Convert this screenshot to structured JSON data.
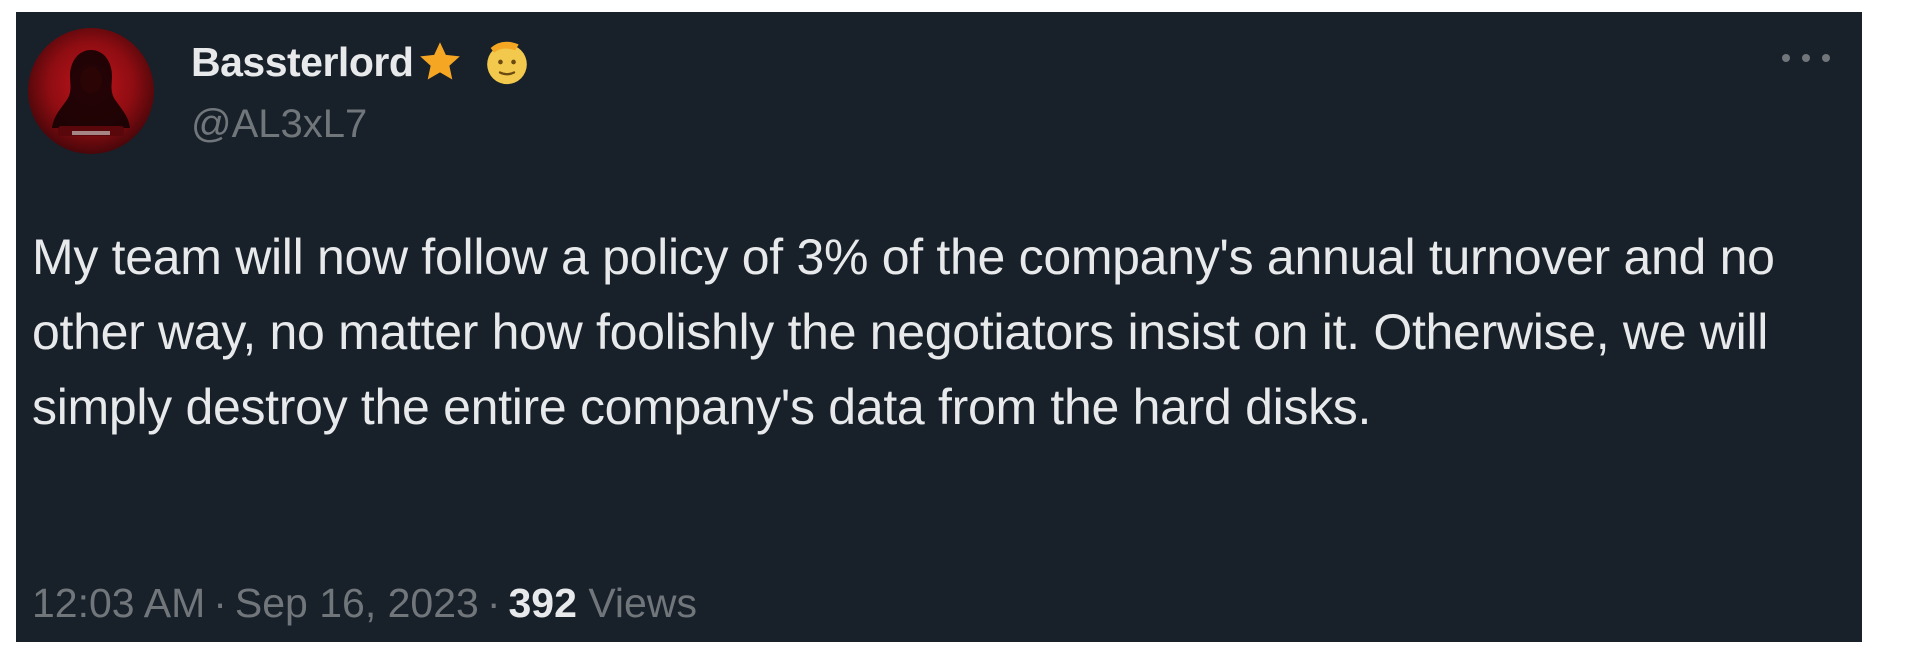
{
  "tweet": {
    "author": {
      "display_name": "Bassterlord",
      "handle": "@AL3xL7",
      "badges": [
        "star-icon",
        "saluting-face-icon"
      ],
      "avatar_icon": "hooded-figure-avatar"
    },
    "text": "My team will now follow a policy of 3% of the company's annual turnover and no other way, no matter how foolishly the negotiators insist on it. Otherwise, we will simply destroy the entire company's data from the hard disks.",
    "time": "12:03 AM",
    "date": "Sep 16, 2023",
    "views_count": "392",
    "views_label": "Views",
    "separator": "·",
    "menu_icon": "more-options-icon"
  },
  "colors": {
    "background": "#18202a",
    "text_primary": "#e7e9ea",
    "text_secondary": "#71767b",
    "star": "#f5a623",
    "emoji": "#f2c94c"
  }
}
